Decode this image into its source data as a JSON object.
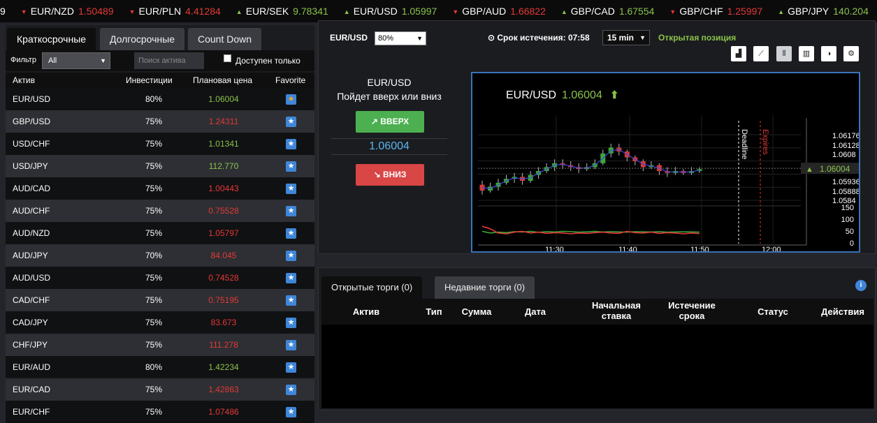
{
  "ticker": [
    {
      "pair": "9",
      "price": "",
      "dir": "none"
    },
    {
      "pair": "EUR/NZD",
      "price": "1.50489",
      "dir": "down"
    },
    {
      "pair": "EUR/PLN",
      "price": "4.41284",
      "dir": "down"
    },
    {
      "pair": "EUR/SEK",
      "price": "9.78341",
      "dir": "up"
    },
    {
      "pair": "EUR/USD",
      "price": "1.05997",
      "dir": "up"
    },
    {
      "pair": "GBP/AUD",
      "price": "1.66822",
      "dir": "down"
    },
    {
      "pair": "GBP/CAD",
      "price": "1.67554",
      "dir": "up"
    },
    {
      "pair": "GBP/CHF",
      "price": "1.25997",
      "dir": "down"
    },
    {
      "pair": "GBP/JPY",
      "price": "140.204",
      "dir": "up"
    }
  ],
  "tabs": [
    "Краткосрочные",
    "Долгосрочные",
    "Count Down"
  ],
  "filter": {
    "label": "Фильтр",
    "value": "All",
    "search_placeholder": "Поиск актива",
    "available_label": "Доступен только"
  },
  "table": {
    "headers": {
      "asset": "Актив",
      "invest": "Инвестиции",
      "price": "Плановая цена",
      "fav": "Favorite"
    },
    "rows": [
      {
        "asset": "EUR/USD",
        "inv": "80%",
        "price": "1.06004",
        "dir": "up",
        "fav": true
      },
      {
        "asset": "GBP/USD",
        "inv": "75%",
        "price": "1.24311",
        "dir": "down",
        "fav": false
      },
      {
        "asset": "USD/CHF",
        "inv": "75%",
        "price": "1.01341",
        "dir": "up",
        "fav": false
      },
      {
        "asset": "USD/JPY",
        "inv": "75%",
        "price": "112.770",
        "dir": "up",
        "fav": false
      },
      {
        "asset": "AUD/CAD",
        "inv": "75%",
        "price": "1.00443",
        "dir": "down",
        "fav": false
      },
      {
        "asset": "AUD/CHF",
        "inv": "75%",
        "price": "0.75528",
        "dir": "down",
        "fav": false
      },
      {
        "asset": "AUD/NZD",
        "inv": "75%",
        "price": "1.05797",
        "dir": "down",
        "fav": false
      },
      {
        "asset": "AUD/JPY",
        "inv": "70%",
        "price": "84.045",
        "dir": "down",
        "fav": false
      },
      {
        "asset": "AUD/USD",
        "inv": "75%",
        "price": "0.74528",
        "dir": "down",
        "fav": false
      },
      {
        "asset": "CAD/CHF",
        "inv": "75%",
        "price": "0.75195",
        "dir": "down",
        "fav": false
      },
      {
        "asset": "CAD/JPY",
        "inv": "75%",
        "price": "83.673",
        "dir": "down",
        "fav": false
      },
      {
        "asset": "CHF/JPY",
        "inv": "75%",
        "price": "111.278",
        "dir": "down",
        "fav": false
      },
      {
        "asset": "EUR/AUD",
        "inv": "80%",
        "price": "1.42234",
        "dir": "up",
        "fav": false
      },
      {
        "asset": "EUR/CAD",
        "inv": "75%",
        "price": "1.42863",
        "dir": "down",
        "fav": false
      },
      {
        "asset": "EUR/CHF",
        "inv": "75%",
        "price": "1.07486",
        "dir": "down",
        "fav": false
      }
    ]
  },
  "trade": {
    "pair_label": "EUR/USD",
    "pair_value": "80%",
    "expiry_label": "Срок истечения: 07:58",
    "expiry_value": "15 min",
    "open_position": "Открытая позиция",
    "box_pair": "EUR/USD",
    "question": "Пойдет вверх или вниз",
    "up_label": "ВВЕРХ",
    "down_label": "ВНИЗ",
    "price": "1.06004"
  },
  "chart_data": {
    "type": "candlestick",
    "title": "EUR/USD",
    "current": "1.06004",
    "y_ticks": [
      "1.06176",
      "1.06128",
      "1.0608",
      "1.05936",
      "1.05888",
      "1.0584"
    ],
    "x_ticks": [
      "11:30",
      "11:40",
      "11:50",
      "12:00"
    ],
    "osc_ticks": [
      "150",
      "100",
      "50",
      "0"
    ],
    "markers": [
      "Deadline",
      "Expires"
    ],
    "candles": [
      {
        "o": 1.0592,
        "c": 1.0589,
        "h": 1.0594,
        "l": 1.0587
      },
      {
        "o": 1.0589,
        "c": 1.0591,
        "h": 1.0593,
        "l": 1.0588
      },
      {
        "o": 1.0591,
        "c": 1.0593,
        "h": 1.0595,
        "l": 1.0589
      },
      {
        "o": 1.0593,
        "c": 1.0595,
        "h": 1.0597,
        "l": 1.0592
      },
      {
        "o": 1.0595,
        "c": 1.0596,
        "h": 1.0598,
        "l": 1.0593
      },
      {
        "o": 1.0596,
        "c": 1.0594,
        "h": 1.0598,
        "l": 1.0592
      },
      {
        "o": 1.0594,
        "c": 1.0597,
        "h": 1.0599,
        "l": 1.0593
      },
      {
        "o": 1.0597,
        "c": 1.0599,
        "h": 1.0601,
        "l": 1.0595
      },
      {
        "o": 1.0599,
        "c": 1.0601,
        "h": 1.0603,
        "l": 1.0598
      },
      {
        "o": 1.0601,
        "c": 1.0603,
        "h": 1.0605,
        "l": 1.0599
      },
      {
        "o": 1.0603,
        "c": 1.0602,
        "h": 1.0605,
        "l": 1.06
      },
      {
        "o": 1.0602,
        "c": 1.0601,
        "h": 1.0604,
        "l": 1.0599
      },
      {
        "o": 1.0601,
        "c": 1.06,
        "h": 1.0603,
        "l": 1.0598
      },
      {
        "o": 1.06,
        "c": 1.0601,
        "h": 1.0603,
        "l": 1.0599
      },
      {
        "o": 1.0601,
        "c": 1.0603,
        "h": 1.0605,
        "l": 1.06
      },
      {
        "o": 1.0603,
        "c": 1.0608,
        "h": 1.061,
        "l": 1.0602
      },
      {
        "o": 1.0608,
        "c": 1.0611,
        "h": 1.0613,
        "l": 1.0606
      },
      {
        "o": 1.0611,
        "c": 1.0609,
        "h": 1.0613,
        "l": 1.0607
      },
      {
        "o": 1.0609,
        "c": 1.0606,
        "h": 1.061,
        "l": 1.0604
      },
      {
        "o": 1.0606,
        "c": 1.0604,
        "h": 1.0607,
        "l": 1.0602
      },
      {
        "o": 1.0604,
        "c": 1.0601,
        "h": 1.0605,
        "l": 1.0599
      },
      {
        "o": 1.0601,
        "c": 1.0602,
        "h": 1.0604,
        "l": 1.06
      },
      {
        "o": 1.0602,
        "c": 1.0599,
        "h": 1.0603,
        "l": 1.0597
      },
      {
        "o": 1.0599,
        "c": 1.0598,
        "h": 1.0601,
        "l": 1.0596
      },
      {
        "o": 1.0598,
        "c": 1.0599,
        "h": 1.0601,
        "l": 1.0597
      },
      {
        "o": 1.0599,
        "c": 1.0598,
        "h": 1.06,
        "l": 1.0597
      },
      {
        "o": 1.0598,
        "c": 1.0599,
        "h": 1.0601,
        "l": 1.0597
      },
      {
        "o": 1.0599,
        "c": 1.06,
        "h": 1.0601,
        "l": 1.0598
      }
    ],
    "osc_green": [
      40,
      30,
      35,
      32,
      38,
      36,
      40,
      34,
      38,
      36,
      40,
      38,
      35,
      37,
      40,
      36,
      38,
      36,
      35,
      38,
      37,
      36,
      38,
      35,
      36,
      37,
      36,
      35
    ],
    "osc_red": [
      70,
      55,
      30,
      25,
      35,
      40,
      30,
      35,
      28,
      32,
      30,
      25,
      30,
      28,
      32,
      35,
      30,
      28,
      40,
      32,
      30,
      35,
      28,
      32,
      30,
      25,
      30,
      26
    ]
  },
  "bottom": {
    "tabs": [
      "Открытые торги (0)",
      "Недавние торги (0)"
    ],
    "headers": [
      "Актив",
      "Тип",
      "Сумма",
      "Дата",
      "Начальная ставка",
      "Истечение срока",
      "Статус",
      "Действия"
    ]
  }
}
